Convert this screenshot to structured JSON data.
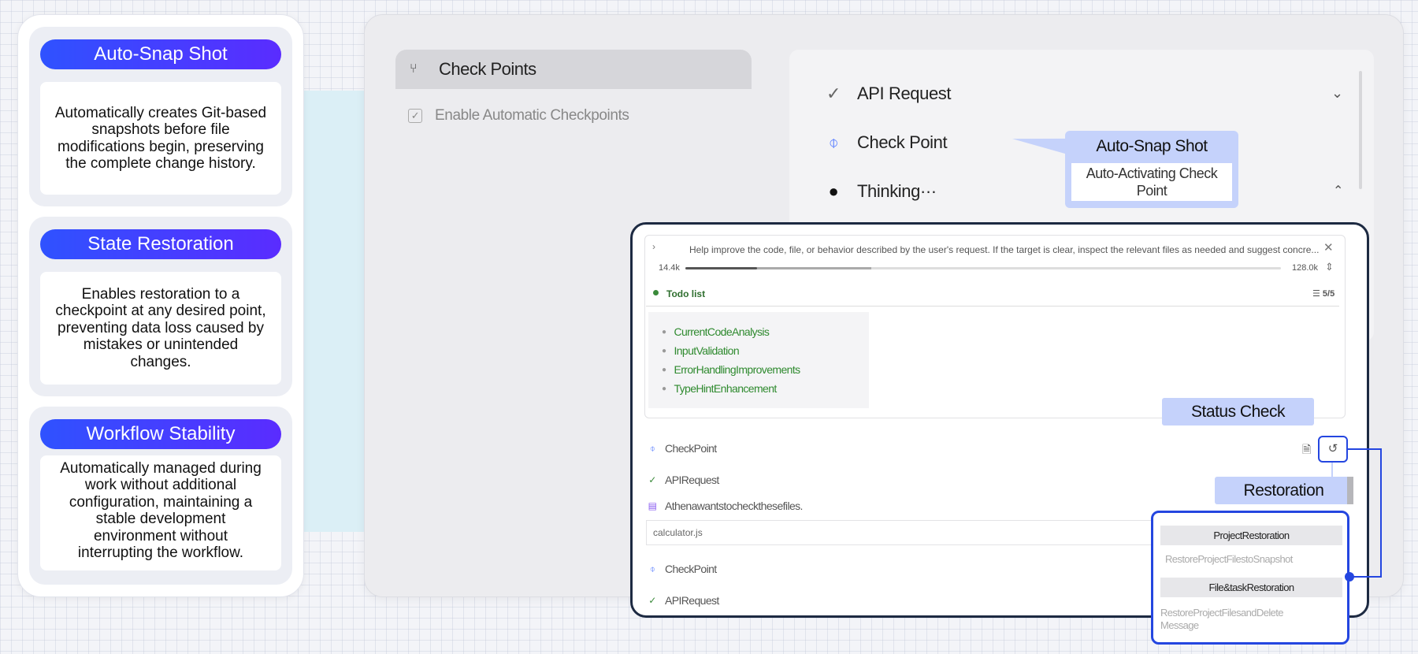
{
  "features": [
    {
      "title": "Auto-Snap Shot",
      "desc": "Automatically creates Git-based snapshots before file modifications begin, preserving the complete change history."
    },
    {
      "title": "State Restoration",
      "desc": "Enables restoration to a checkpoint at any desired point, preventing data loss caused by mistakes or unintended changes."
    },
    {
      "title": "Workflow Stability",
      "desc": "Automatically managed during work without additional configuration, maintaining a stable development environment without interrupting the workflow."
    }
  ],
  "settings": {
    "header": "Check Points",
    "option_label": "Enable Automatic Checkpoints",
    "option_checked": true
  },
  "right_panel": {
    "items": [
      "API Request",
      "Check Point",
      "Thinking···"
    ]
  },
  "callouts": {
    "snap_title": "Auto-Snap Shot",
    "snap_body": "Auto-Activating Check Point",
    "status": "Status Check",
    "restoration": "Restoration"
  },
  "task": {
    "text": "Help improve the code, file, or behavior described by the user's request. If the target is clear, inspect the relevant files as needed and suggest concre...",
    "tokens_used": "14.4k",
    "tokens_max": "128.0k",
    "progress_fraction": 0.12
  },
  "todo": {
    "label": "Todo list",
    "count": "5/5",
    "items": [
      "CurrentCodeAnalysis",
      "InputValidation",
      "ErrorHandlingImprovements",
      "TypeHintEnhancement"
    ]
  },
  "activity": {
    "checkpoint": "CheckPoint",
    "api_request": "APIRequest",
    "files_msg": "Athenawantstocheckthesefiles.",
    "file": "calculator.js"
  },
  "restoration_menu": {
    "project_title": "ProjectRestoration",
    "project_desc": "RestoreProjectFilestoSnapshot",
    "file_task_title": "File&taskRestoration",
    "file_task_desc": "RestoreProjectFilesandDelete Message"
  },
  "colors": {
    "accent": "#2446e0",
    "callout": "#c5d2fb",
    "todo_green": "#2f8a2f"
  }
}
